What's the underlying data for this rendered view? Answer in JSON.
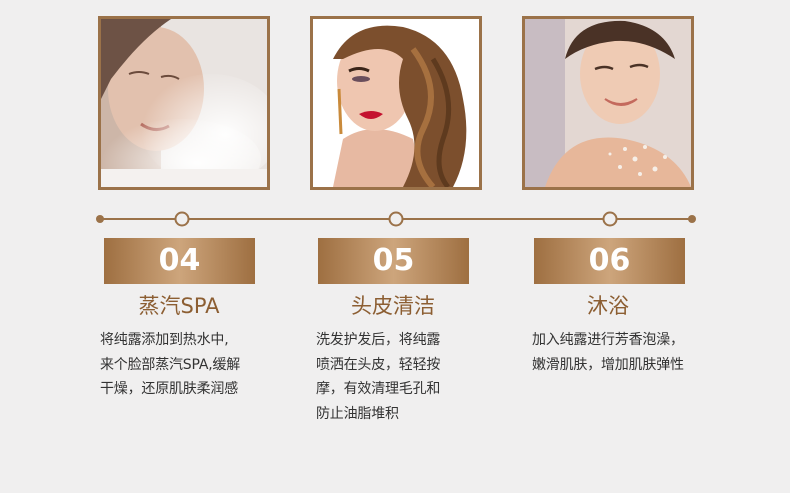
{
  "colors": {
    "accent": "#9b7249",
    "title": "#8c5e32",
    "text": "#333333",
    "background": "#f0efef"
  },
  "steps": [
    {
      "number": "04",
      "title": "蒸汽SPA",
      "desc": [
        "将纯露添加到热水中,",
        "来个脸部蒸汽SPA,缓解",
        "干燥，还原肌肤柔润感"
      ],
      "image": "woman-steam-facial-photo"
    },
    {
      "number": "05",
      "title": "头皮清洁",
      "desc": [
        "洗发护发后，将纯露",
        "喷洒在头皮，轻轻按",
        "摩，有效清理毛孔和",
        "防止油脂堆积"
      ],
      "image": "woman-wavy-hair-photo"
    },
    {
      "number": "06",
      "title": "沐浴",
      "desc": [
        "加入纯露进行芳香泡澡，",
        "嫩滑肌肤，增加肌肤弹性"
      ],
      "image": "woman-bath-photo"
    }
  ]
}
